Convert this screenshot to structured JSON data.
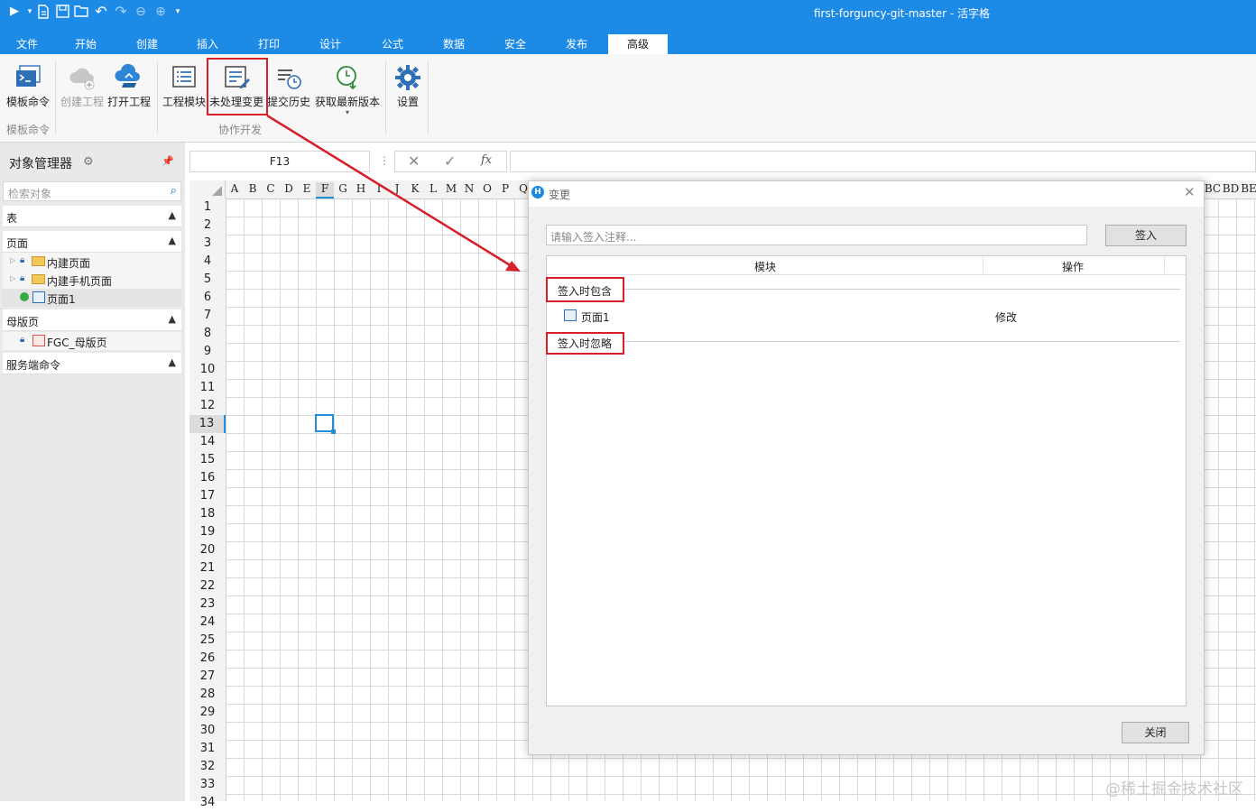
{
  "window": {
    "title": "first-forguncy-git-master - 活字格"
  },
  "menu_tabs": [
    "文件",
    "开始",
    "创建",
    "插入",
    "打印",
    "设计",
    "公式",
    "数据",
    "安全",
    "发布",
    "高级"
  ],
  "active_tab": "高级",
  "ribbon": {
    "buttons": {
      "template_cmd": "模板命令",
      "create_project": "创建工程",
      "open_project": "打开工程",
      "project_module": "工程模块",
      "pending_changes": "未处理变更",
      "commit_history": "提交历史",
      "get_latest": "获取最新版本",
      "settings": "设置"
    },
    "groups": {
      "template": "模板命令",
      "collab": "协作开发"
    }
  },
  "object_manager": {
    "title": "对象管理器",
    "search_placeholder": "检索对象",
    "sections": {
      "tables": "表",
      "pages": "页面",
      "master_pages": "母版页",
      "server_commands": "服务端命令"
    },
    "page_items": [
      "内建页面",
      "内建手机页面",
      "页面1"
    ],
    "master_items": [
      "FGC_母版页"
    ]
  },
  "formula_bar": {
    "cell_ref": "F13"
  },
  "grid": {
    "columns": [
      "A",
      "B",
      "C",
      "D",
      "E",
      "F",
      "G",
      "H",
      "I",
      "J",
      "K",
      "L",
      "M",
      "N",
      "O",
      "P",
      "Q"
    ],
    "right_columns": [
      "BC",
      "BD",
      "BE"
    ],
    "rows": [
      "1",
      "2",
      "3",
      "4",
      "5",
      "6",
      "7",
      "8",
      "9",
      "10",
      "11",
      "12",
      "13",
      "14",
      "15",
      "16",
      "17",
      "18",
      "19",
      "20",
      "21",
      "22",
      "23",
      "24",
      "25",
      "26",
      "27",
      "28",
      "29",
      "30",
      "31",
      "32",
      "33",
      "34"
    ],
    "selected_column": "F",
    "selected_row": "13"
  },
  "dialog": {
    "title": "变更",
    "comment_placeholder": "请输入签入注释...",
    "checkin_button": "签入",
    "columns": {
      "module": "模块",
      "action": "操作"
    },
    "group_include": "签入时包含",
    "group_ignore": "签入时忽略",
    "rows": [
      {
        "module": "页面1",
        "action": "修改"
      }
    ],
    "close_button": "关闭"
  },
  "watermark": "@稀土掘金技术社区",
  "colors": {
    "accent": "#1d8ae6",
    "highlight_box": "#d8202a"
  }
}
